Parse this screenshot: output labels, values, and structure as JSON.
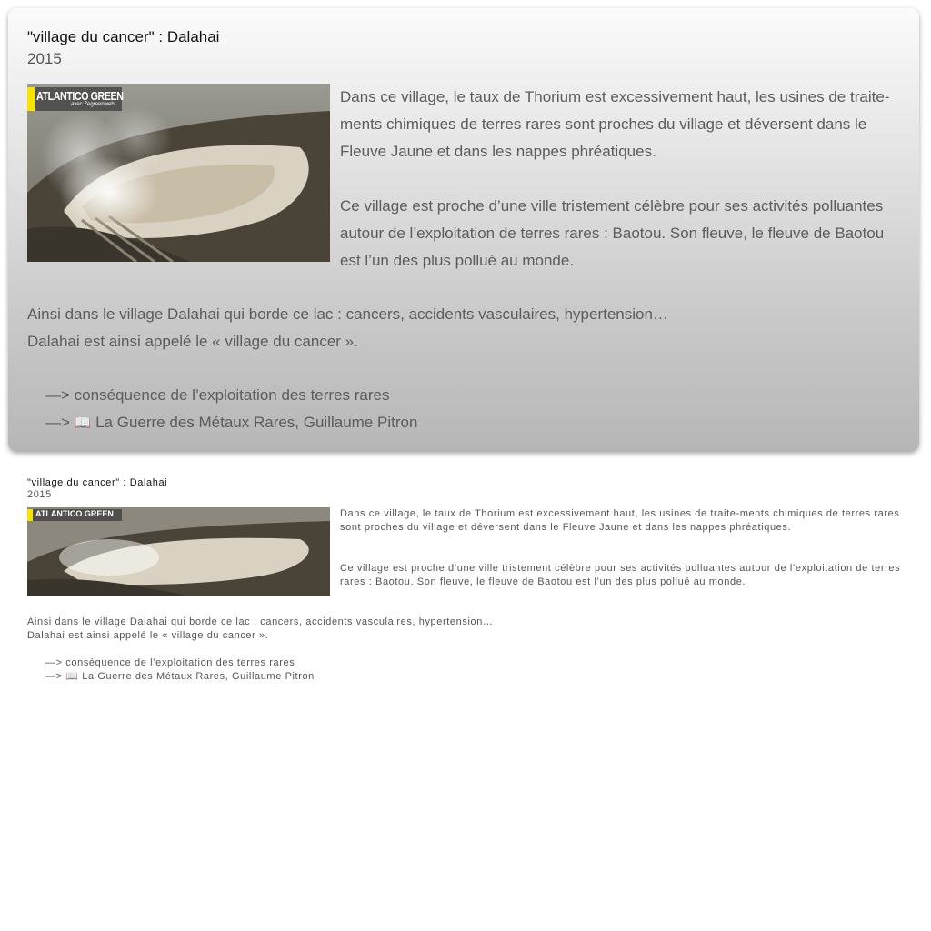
{
  "post": {
    "title": "\"village du cancer\" : Dalahai",
    "year": "2015",
    "image_badge": {
      "title": "ATLANTICO GREEN",
      "subtitle": "avec Zegreenweb"
    },
    "paragraph1": "Dans ce village, le taux de Thorium est excessivement haut, les usines de traite-ments chimiques de terres rares sont proches du village et déversent dans le Fleuve Jaune et dans les nappes phréatiques.",
    "paragraph2": "Ce village est proche d’une ville tristement célèbre pour ses activités polluantes autour de l’exploitation de terres rares : Baotou. Son fleuve, le fleuve de Baotou est l’un des plus pollué au monde.",
    "paragraph3_line1": "Ainsi dans le village Dalahai qui borde ce lac : cancers, accidents vasculaires, hypertension…",
    "paragraph3_line2": "Dalahai est ainsi appelé le « village du cancer ».",
    "link1_arrow": "—>",
    "link1_text": "conséquence de l’exploitation des terres rares",
    "link2_arrow": "—>",
    "link2_icon": "open-book-icon",
    "link2_text": "La Guerre des Métaux Rares, Guillaume Pitron"
  },
  "colors": {
    "card_top": "#fbfbfb",
    "card_bottom": "#b6b6b6",
    "badge_accent": "#f6e400"
  }
}
